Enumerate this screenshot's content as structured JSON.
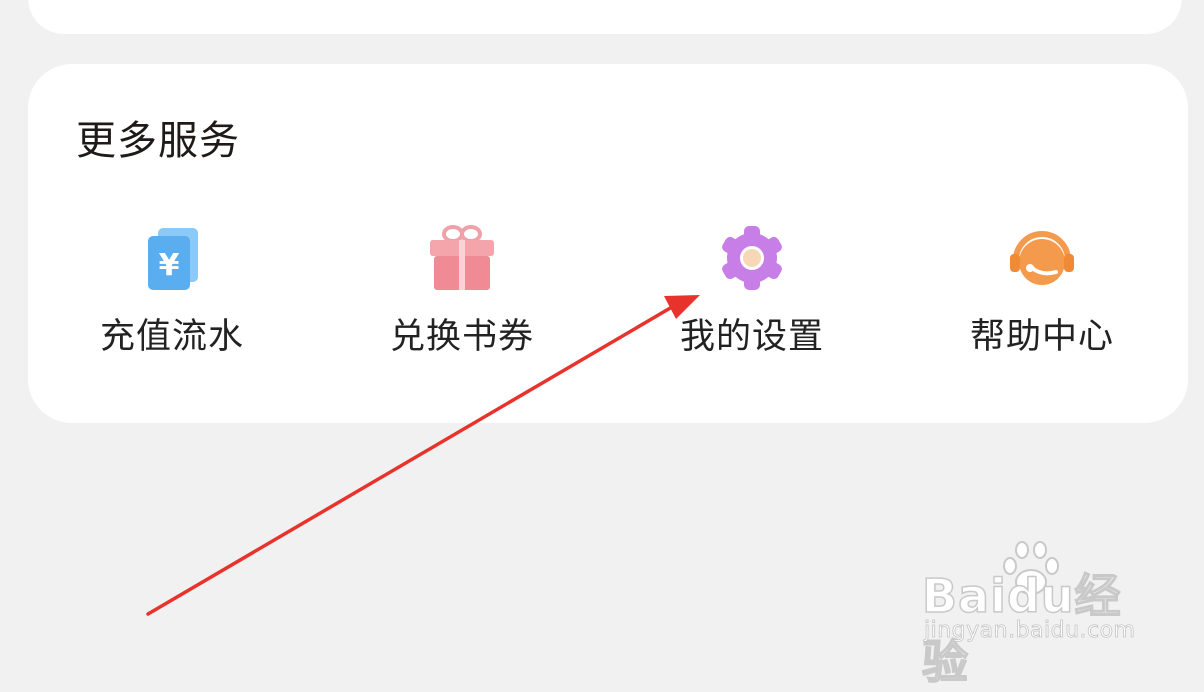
{
  "services": {
    "title": "更多服务",
    "items": [
      {
        "label": "充值流水",
        "icon": "recharge-record-icon"
      },
      {
        "label": "兑换书券",
        "icon": "gift-icon"
      },
      {
        "label": "我的设置",
        "icon": "gear-icon"
      },
      {
        "label": "帮助中心",
        "icon": "headset-icon"
      }
    ]
  },
  "colors": {
    "background": "#f1f1f1",
    "card": "#ffffff",
    "recharge_icon": "#5aaef0",
    "gift_icon": "#f08b95",
    "settings_icon": "#c77ee6",
    "help_icon": "#f39a4c",
    "annotation_arrow": "#e8332d"
  },
  "watermark": {
    "brand": "Baidu经验",
    "url": "jingyan.baidu.com"
  }
}
